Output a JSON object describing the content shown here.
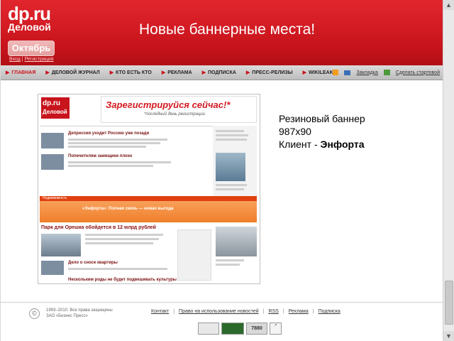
{
  "header": {
    "logo_text": "dp.ru",
    "logo_sub": "Деловой",
    "month_button": "Октябрь",
    "login": "Вход",
    "register": "Регистрация",
    "slide_title": "Новые баннерные места!"
  },
  "nav": {
    "items": [
      "ГЛАВНАЯ",
      "ДЕЛОВОЙ ЖУРНАЛ",
      "КТО ЕСТЬ КТО",
      "РЕКЛАМА",
      "ПОДПИСКА",
      "ПРЕСС-РЕЛИЗЫ",
      "WIKILEAKS"
    ],
    "bookmark": "Закладка",
    "make_home": "Сделать стартовой"
  },
  "preview": {
    "logo": "dp.ru",
    "logo_sub": "Деловой",
    "banner_title": "Зарегистрируйся сейчас!*",
    "banner_sub": "*последний день регистрации",
    "headline_1": "Депрессия уходит Россию уже позади",
    "headline_2": "Попечителям заемщики плохо",
    "realty_label": "Недвижимость",
    "promo_title": "«Энфорта»: Полная связь — новая выгода",
    "headline_3": "Парк для Орешка обойдется в 12 млрд рублей",
    "headline_4": "Дело о сносе квартиры",
    "headline_5": "Нескольким роды не будет подвешивать культуры"
  },
  "side": {
    "line1": "Резиновый баннер",
    "line2": "987х90",
    "client_label": "Клиент - ",
    "client_name": "Энфорта"
  },
  "footer": {
    "copyright_1": "1993–2010. Все права защищены",
    "copyright_2": "ЗАО «Бизнес Пресс»",
    "links": [
      "Контакт",
      "Право на использование новостей",
      "RSS",
      "Реклама",
      "Подписка"
    ],
    "counter_number": "7880"
  }
}
